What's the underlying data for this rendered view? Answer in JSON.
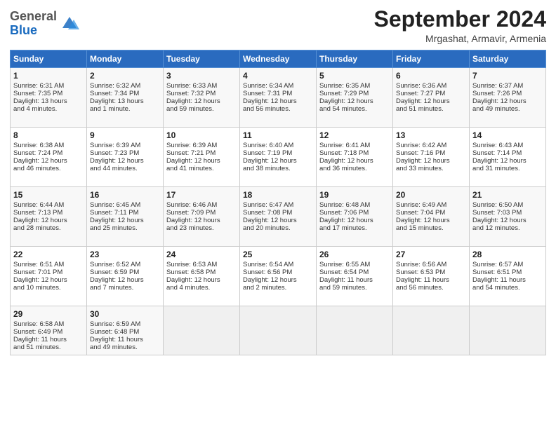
{
  "header": {
    "logo_general": "General",
    "logo_blue": "Blue",
    "month_title": "September 2024",
    "subtitle": "Mrgashat, Armavir, Armenia"
  },
  "days_of_week": [
    "Sunday",
    "Monday",
    "Tuesday",
    "Wednesday",
    "Thursday",
    "Friday",
    "Saturday"
  ],
  "weeks": [
    [
      {
        "day": "1",
        "lines": [
          "Sunrise: 6:31 AM",
          "Sunset: 7:35 PM",
          "Daylight: 13 hours",
          "and 4 minutes."
        ]
      },
      {
        "day": "2",
        "lines": [
          "Sunrise: 6:32 AM",
          "Sunset: 7:34 PM",
          "Daylight: 13 hours",
          "and 1 minute."
        ]
      },
      {
        "day": "3",
        "lines": [
          "Sunrise: 6:33 AM",
          "Sunset: 7:32 PM",
          "Daylight: 12 hours",
          "and 59 minutes."
        ]
      },
      {
        "day": "4",
        "lines": [
          "Sunrise: 6:34 AM",
          "Sunset: 7:31 PM",
          "Daylight: 12 hours",
          "and 56 minutes."
        ]
      },
      {
        "day": "5",
        "lines": [
          "Sunrise: 6:35 AM",
          "Sunset: 7:29 PM",
          "Daylight: 12 hours",
          "and 54 minutes."
        ]
      },
      {
        "day": "6",
        "lines": [
          "Sunrise: 6:36 AM",
          "Sunset: 7:27 PM",
          "Daylight: 12 hours",
          "and 51 minutes."
        ]
      },
      {
        "day": "7",
        "lines": [
          "Sunrise: 6:37 AM",
          "Sunset: 7:26 PM",
          "Daylight: 12 hours",
          "and 49 minutes."
        ]
      }
    ],
    [
      {
        "day": "8",
        "lines": [
          "Sunrise: 6:38 AM",
          "Sunset: 7:24 PM",
          "Daylight: 12 hours",
          "and 46 minutes."
        ]
      },
      {
        "day": "9",
        "lines": [
          "Sunrise: 6:39 AM",
          "Sunset: 7:23 PM",
          "Daylight: 12 hours",
          "and 44 minutes."
        ]
      },
      {
        "day": "10",
        "lines": [
          "Sunrise: 6:39 AM",
          "Sunset: 7:21 PM",
          "Daylight: 12 hours",
          "and 41 minutes."
        ]
      },
      {
        "day": "11",
        "lines": [
          "Sunrise: 6:40 AM",
          "Sunset: 7:19 PM",
          "Daylight: 12 hours",
          "and 38 minutes."
        ]
      },
      {
        "day": "12",
        "lines": [
          "Sunrise: 6:41 AM",
          "Sunset: 7:18 PM",
          "Daylight: 12 hours",
          "and 36 minutes."
        ]
      },
      {
        "day": "13",
        "lines": [
          "Sunrise: 6:42 AM",
          "Sunset: 7:16 PM",
          "Daylight: 12 hours",
          "and 33 minutes."
        ]
      },
      {
        "day": "14",
        "lines": [
          "Sunrise: 6:43 AM",
          "Sunset: 7:14 PM",
          "Daylight: 12 hours",
          "and 31 minutes."
        ]
      }
    ],
    [
      {
        "day": "15",
        "lines": [
          "Sunrise: 6:44 AM",
          "Sunset: 7:13 PM",
          "Daylight: 12 hours",
          "and 28 minutes."
        ]
      },
      {
        "day": "16",
        "lines": [
          "Sunrise: 6:45 AM",
          "Sunset: 7:11 PM",
          "Daylight: 12 hours",
          "and 25 minutes."
        ]
      },
      {
        "day": "17",
        "lines": [
          "Sunrise: 6:46 AM",
          "Sunset: 7:09 PM",
          "Daylight: 12 hours",
          "and 23 minutes."
        ]
      },
      {
        "day": "18",
        "lines": [
          "Sunrise: 6:47 AM",
          "Sunset: 7:08 PM",
          "Daylight: 12 hours",
          "and 20 minutes."
        ]
      },
      {
        "day": "19",
        "lines": [
          "Sunrise: 6:48 AM",
          "Sunset: 7:06 PM",
          "Daylight: 12 hours",
          "and 17 minutes."
        ]
      },
      {
        "day": "20",
        "lines": [
          "Sunrise: 6:49 AM",
          "Sunset: 7:04 PM",
          "Daylight: 12 hours",
          "and 15 minutes."
        ]
      },
      {
        "day": "21",
        "lines": [
          "Sunrise: 6:50 AM",
          "Sunset: 7:03 PM",
          "Daylight: 12 hours",
          "and 12 minutes."
        ]
      }
    ],
    [
      {
        "day": "22",
        "lines": [
          "Sunrise: 6:51 AM",
          "Sunset: 7:01 PM",
          "Daylight: 12 hours",
          "and 10 minutes."
        ]
      },
      {
        "day": "23",
        "lines": [
          "Sunrise: 6:52 AM",
          "Sunset: 6:59 PM",
          "Daylight: 12 hours",
          "and 7 minutes."
        ]
      },
      {
        "day": "24",
        "lines": [
          "Sunrise: 6:53 AM",
          "Sunset: 6:58 PM",
          "Daylight: 12 hours",
          "and 4 minutes."
        ]
      },
      {
        "day": "25",
        "lines": [
          "Sunrise: 6:54 AM",
          "Sunset: 6:56 PM",
          "Daylight: 12 hours",
          "and 2 minutes."
        ]
      },
      {
        "day": "26",
        "lines": [
          "Sunrise: 6:55 AM",
          "Sunset: 6:54 PM",
          "Daylight: 11 hours",
          "and 59 minutes."
        ]
      },
      {
        "day": "27",
        "lines": [
          "Sunrise: 6:56 AM",
          "Sunset: 6:53 PM",
          "Daylight: 11 hours",
          "and 56 minutes."
        ]
      },
      {
        "day": "28",
        "lines": [
          "Sunrise: 6:57 AM",
          "Sunset: 6:51 PM",
          "Daylight: 11 hours",
          "and 54 minutes."
        ]
      }
    ],
    [
      {
        "day": "29",
        "lines": [
          "Sunrise: 6:58 AM",
          "Sunset: 6:49 PM",
          "Daylight: 11 hours",
          "and 51 minutes."
        ]
      },
      {
        "day": "30",
        "lines": [
          "Sunrise: 6:59 AM",
          "Sunset: 6:48 PM",
          "Daylight: 11 hours",
          "and 49 minutes."
        ]
      },
      {
        "day": "",
        "lines": []
      },
      {
        "day": "",
        "lines": []
      },
      {
        "day": "",
        "lines": []
      },
      {
        "day": "",
        "lines": []
      },
      {
        "day": "",
        "lines": []
      }
    ]
  ]
}
